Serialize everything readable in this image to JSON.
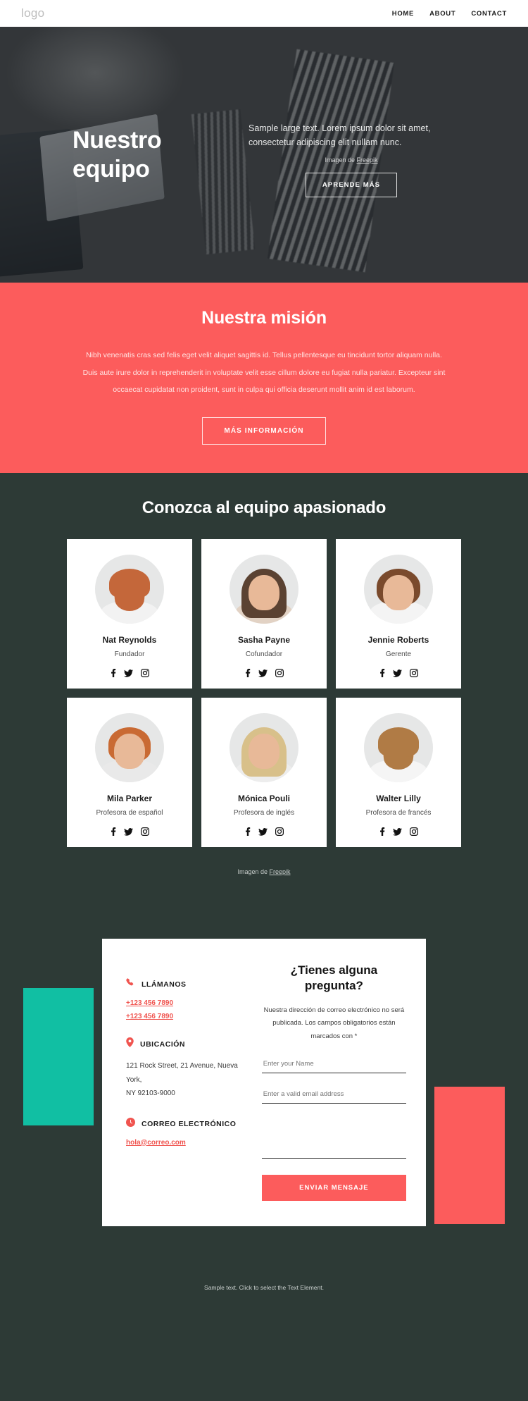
{
  "header": {
    "logo": "logo",
    "nav": [
      {
        "label": "HOME"
      },
      {
        "label": "ABOUT"
      },
      {
        "label": "CONTACT"
      }
    ]
  },
  "hero": {
    "title": "Nuestro equipo",
    "subtitle": "Sample large text. Lorem ipsum dolor sit amet, consectetur adipiscing elit nullam nunc.",
    "credit_prefix": "Imagen de ",
    "credit_link": "Freepik",
    "cta": "APRENDE MÁS"
  },
  "mission": {
    "title": "Nuestra misión",
    "text": "Nibh venenatis cras sed felis eget velit aliquet sagittis id. Tellus pellentesque eu tincidunt tortor aliquam nulla. Duis aute irure dolor in reprehenderit in voluptate velit esse cillum dolore eu fugiat nulla pariatur. Excepteur sint occaecat cupidatat non proident, sunt in culpa qui officia deserunt mollit anim id est laborum.",
    "cta": "MÁS INFORMACIÓN",
    "accent_color": "#fc5c5c"
  },
  "team": {
    "title": "Conozca al equipo apasionado",
    "credit_prefix": "Imagen de ",
    "credit_link": "Freepik",
    "members": [
      {
        "name": "Nat Reynolds",
        "role": "Fundador"
      },
      {
        "name": "Sasha Payne",
        "role": "Cofundador"
      },
      {
        "name": "Jennie Roberts",
        "role": "Gerente"
      },
      {
        "name": "Mila Parker",
        "role": "Profesora de español"
      },
      {
        "name": "Mónica Pouli",
        "role": "Profesora de inglés"
      },
      {
        "name": "Walter Lilly",
        "role": "Profesora de francés"
      }
    ],
    "social_icons": [
      "facebook-icon",
      "twitter-icon",
      "instagram-icon"
    ],
    "background_color": "#2d3a36"
  },
  "contact": {
    "call": {
      "icon": "phone-icon",
      "title": "LLÁMANOS",
      "phone1": "+123 456 7890",
      "phone2": "+123 456 7890"
    },
    "location": {
      "icon": "map-pin-icon",
      "title": "UBICACIÓN",
      "line1": "121 Rock Street, 21 Avenue, Nueva York,",
      "line2": "NY 92103-9000"
    },
    "email": {
      "icon": "email-icon",
      "title": "CORREO ELECTRÓNICO",
      "address": "hola@correo.com"
    },
    "form": {
      "title": "¿Tienes alguna pregunta?",
      "description": "Nuestra dirección de correo electrónico no será publicada. Los campos obligatorios están marcados con *",
      "name_placeholder": "Enter your Name",
      "name_value": "",
      "email_placeholder": "Enter a valid email address",
      "email_value": "",
      "message_placeholder": "",
      "message_value": "",
      "submit": "ENVIAR MENSAJE",
      "submit_color": "#fc5c5c"
    },
    "deco_teal_color": "#11bfa3",
    "deco_red_color": "#fc5c5c"
  },
  "footer": {
    "text": "Sample text. Click to select the Text Element."
  }
}
